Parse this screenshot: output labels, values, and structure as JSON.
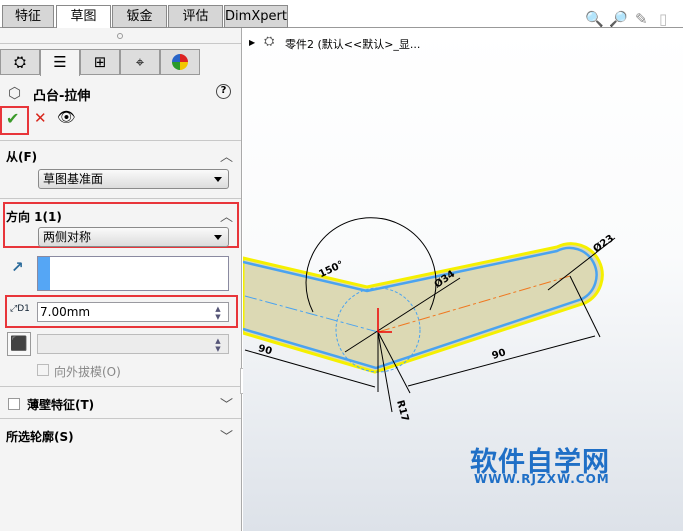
{
  "tabs": [
    {
      "label": "特征"
    },
    {
      "label": "草图"
    },
    {
      "label": "钣金"
    },
    {
      "label": "评估"
    },
    {
      "label": "DimXpert"
    }
  ],
  "panel": {
    "feature_title": "凸台-拉伸",
    "help_icon": "?",
    "from_section": {
      "label": "从(F)",
      "selected": "草图基准面"
    },
    "direction1": {
      "label": "方向 1(1)",
      "selected": "两侧对称",
      "depth": "7.00mm",
      "draft_label": "向外拔模(O)"
    },
    "thin_feature": {
      "label": "薄壁特征(T)"
    },
    "selected_contours": {
      "label": "所选轮廓(S)"
    }
  },
  "tree": {
    "label": "零件2  (默认<<默认>_显..."
  },
  "dimensions": {
    "angle": "150°",
    "dia_center": "Ø34",
    "dia_end": "Ø23",
    "len_left": "90",
    "len_right": "90",
    "radius": "R17"
  },
  "watermark": {
    "title": "软件自学网",
    "url": "WWW.RJZXW.COM"
  },
  "colors": {
    "accent_red": "#e8353a",
    "body_fill": "#dcd9b4",
    "edge_blue": "#4aa3f0",
    "highlight_yellow": "#f5f000",
    "watermark": "#1f6fc6"
  }
}
